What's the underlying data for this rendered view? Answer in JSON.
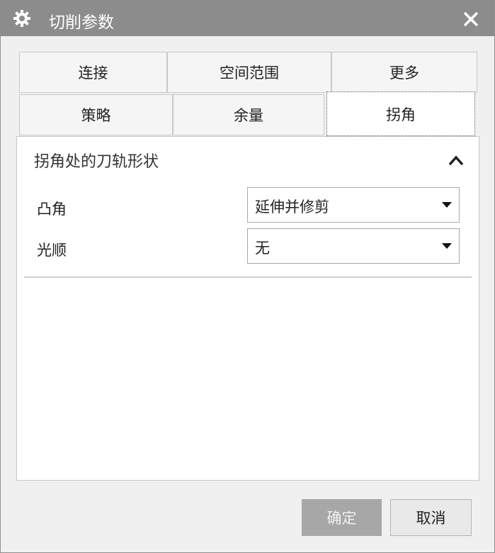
{
  "window": {
    "title": "切削参数",
    "icons": {
      "title": "gear-icon",
      "close": "close-icon"
    }
  },
  "tabs": {
    "row1": [
      {
        "label": "连接"
      },
      {
        "label": "空间范围"
      },
      {
        "label": "更多"
      }
    ],
    "row2": [
      {
        "label": "策略"
      },
      {
        "label": "余量"
      },
      {
        "label": "拐角",
        "active": true
      }
    ]
  },
  "panel": {
    "group_title": "拐角处的刀轨形状",
    "collapse_icon": "chevron-up-icon",
    "rows": [
      {
        "label": "凸角",
        "value": "延伸并修剪"
      },
      {
        "label": "光顺",
        "value": "无"
      }
    ]
  },
  "buttons": {
    "ok": "确定",
    "cancel": "取消"
  },
  "colors": {
    "titlebar": "#8c8c8c",
    "ok_disabled": "#a7a7a7"
  }
}
